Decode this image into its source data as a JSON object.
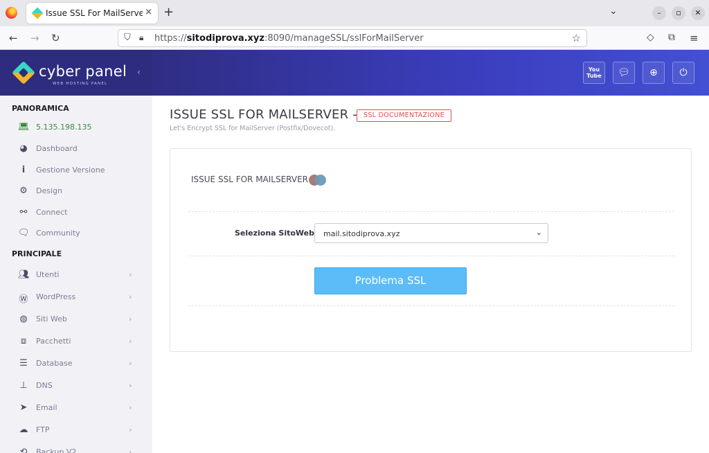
{
  "browser": {
    "tab_title": "Issue SSL For MailServer - ",
    "tab_close": "×",
    "new_tab": "+",
    "url_domain": "sitodiprova.xyz",
    "url_prefix": "https://",
    "url_rest": ":8090/manageSSL/sslForMailServer",
    "icons": [
      "firefox-icon",
      "back-arrow-icon",
      "forward-arrow-icon",
      "reload-icon",
      "shield-icon",
      "lock-icon",
      "star-icon",
      "pocket-icon",
      "extensions-icon",
      "menu-icon"
    ]
  },
  "brand": {
    "name": "cyber panel",
    "tagline": "WEB HOSTING PANEL"
  },
  "topbar": {
    "youtube_label_1": "You",
    "youtube_label_2": "Tube",
    "buttons": [
      "youtube-icon",
      "chat-icon",
      "lifebuoy-icon",
      "power-icon"
    ]
  },
  "sidebar": {
    "section_1": "PANORAMICA",
    "overview_items": [
      {
        "label": "5.135.198.135",
        "icon": "laptop-icon"
      },
      {
        "label": "Dashboard",
        "icon": "dashboard-icon"
      },
      {
        "label": "Gestione Versione",
        "icon": "info-icon"
      },
      {
        "label": "Design",
        "icon": "gear-icon"
      },
      {
        "label": "Connect",
        "icon": "link-icon"
      },
      {
        "label": "Community",
        "icon": "comments-icon"
      }
    ],
    "section_2": "PRINCIPALE",
    "main_items": [
      {
        "label": "Utenti",
        "icon": "users-icon"
      },
      {
        "label": "WordPress",
        "icon": "wordpress-icon"
      },
      {
        "label": "Siti Web",
        "icon": "globe-icon"
      },
      {
        "label": "Pacchetti",
        "icon": "cubes-icon"
      },
      {
        "label": "Database",
        "icon": "database-icon"
      },
      {
        "label": "DNS",
        "icon": "sitemap-icon"
      },
      {
        "label": "Email",
        "icon": "paper-plane-icon"
      },
      {
        "label": "FTP",
        "icon": "cloud-upload-icon"
      },
      {
        "label": "Backup V2",
        "icon": "backup-icon"
      }
    ]
  },
  "main": {
    "title": "ISSUE SSL FOR MAILSERVER -",
    "doc_badge": "SSL DOCUMENTAZIONE",
    "subtitle": "Let's Encrypt SSL for MailServer (Postfix/Dovecot).",
    "card": {
      "heading": "ISSUE SSL FOR MAILSERVER",
      "field_label": "Seleziona SitoWeb",
      "select_value": "mail.sitodiprova.xyz",
      "submit_label": "Problema SSL"
    }
  },
  "colors": {
    "brand_bg": "#2e2c7e",
    "topbar_start": "#2f2d84",
    "topbar_end": "#4350d2",
    "button_primary": "#5bbcf7",
    "badge_red": "#e34b4b",
    "ip_green": "#3c8a3f"
  }
}
